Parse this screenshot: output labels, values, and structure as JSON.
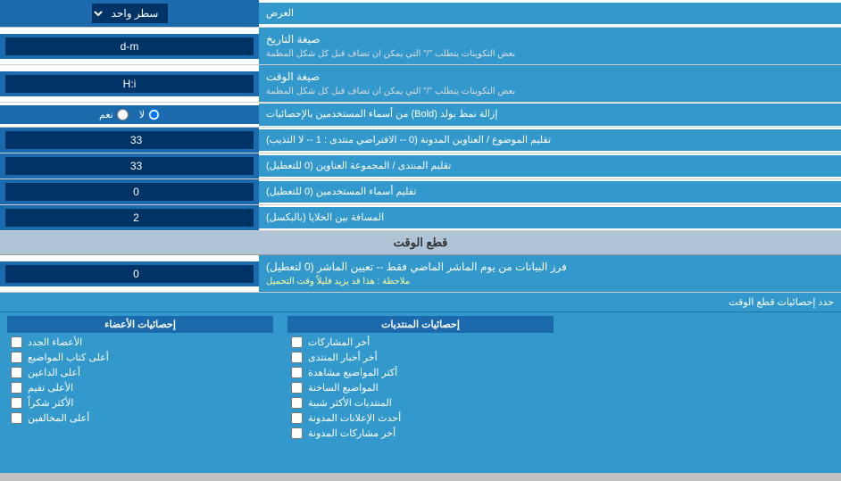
{
  "header": {
    "title": "العرض",
    "dropdown_label": "سطر واحد",
    "dropdown_icon": "▼"
  },
  "rows": [
    {
      "id": "date_format",
      "label_main": "صيغة التاريخ",
      "label_sub": "بعض التكوينات يتطلب \"/\" التي يمكن ان تضاف قبل كل شكل المطمة",
      "input_value": "d-m"
    },
    {
      "id": "time_format",
      "label_main": "صيغة الوقت",
      "label_sub": "بعض التكوينات يتطلب \"/\" التي يمكن ان تضاف قبل كل شكل المطمة",
      "input_value": "H:i"
    },
    {
      "id": "bold_remove",
      "label_main": "إزالة نمط بولد (Bold) من أسماء المستخدمين بالإحصائيات",
      "radio_yes": "نعم",
      "radio_no": "لا",
      "selected": "no"
    },
    {
      "id": "topic_titles",
      "label_main": "تقليم الموضوع / العناوين المدونة (0 -- الافتراضي منتدى : 1 -- لا التذيب)",
      "input_value": "33"
    },
    {
      "id": "forum_group",
      "label_main": "تقليم المنتدى / المجموعة العناوين (0 للتعطيل)",
      "input_value": "33"
    },
    {
      "id": "usernames_trim",
      "label_main": "تقليم أسماء المستخدمين (0 للتعطيل)",
      "input_value": "0"
    },
    {
      "id": "cell_gap",
      "label_main": "المسافة بين الخلايا (بالبكسل)",
      "input_value": "2"
    }
  ],
  "section_realtime": {
    "title": "قطع الوقت",
    "row": {
      "label_main": "فرز البيانات من يوم الماشر الماضي فقط -- تعيين الماشر (0 لتعطيل)",
      "label_note": "ملاحظة : هذا قد يزيد قليلاً وقت التحميل",
      "input_value": "0"
    },
    "stats_header": "حدد إحصائيات قطع الوقت",
    "col_posts": {
      "title": "إحصائيات المنتديات",
      "items": [
        "أخر المشاركات",
        "أخر أخبار المنتدى",
        "أكثر المواضيع مشاهدة",
        "المواضيع الساخنة",
        "المنتديات الأكثر شبية",
        "أحدث الإعلانات المدونة",
        "أخر مشاركات المدونة"
      ]
    },
    "col_members": {
      "title": "إحصائيات الأعضاء",
      "items": [
        "الأعضاء الجدد",
        "أعلى كتاب المواضيع",
        "أعلى الداعين",
        "الأعلى تقيم",
        "الأكثر شكراً",
        "أعلى المخالفين"
      ]
    },
    "col_empty": {
      "title": ""
    }
  }
}
